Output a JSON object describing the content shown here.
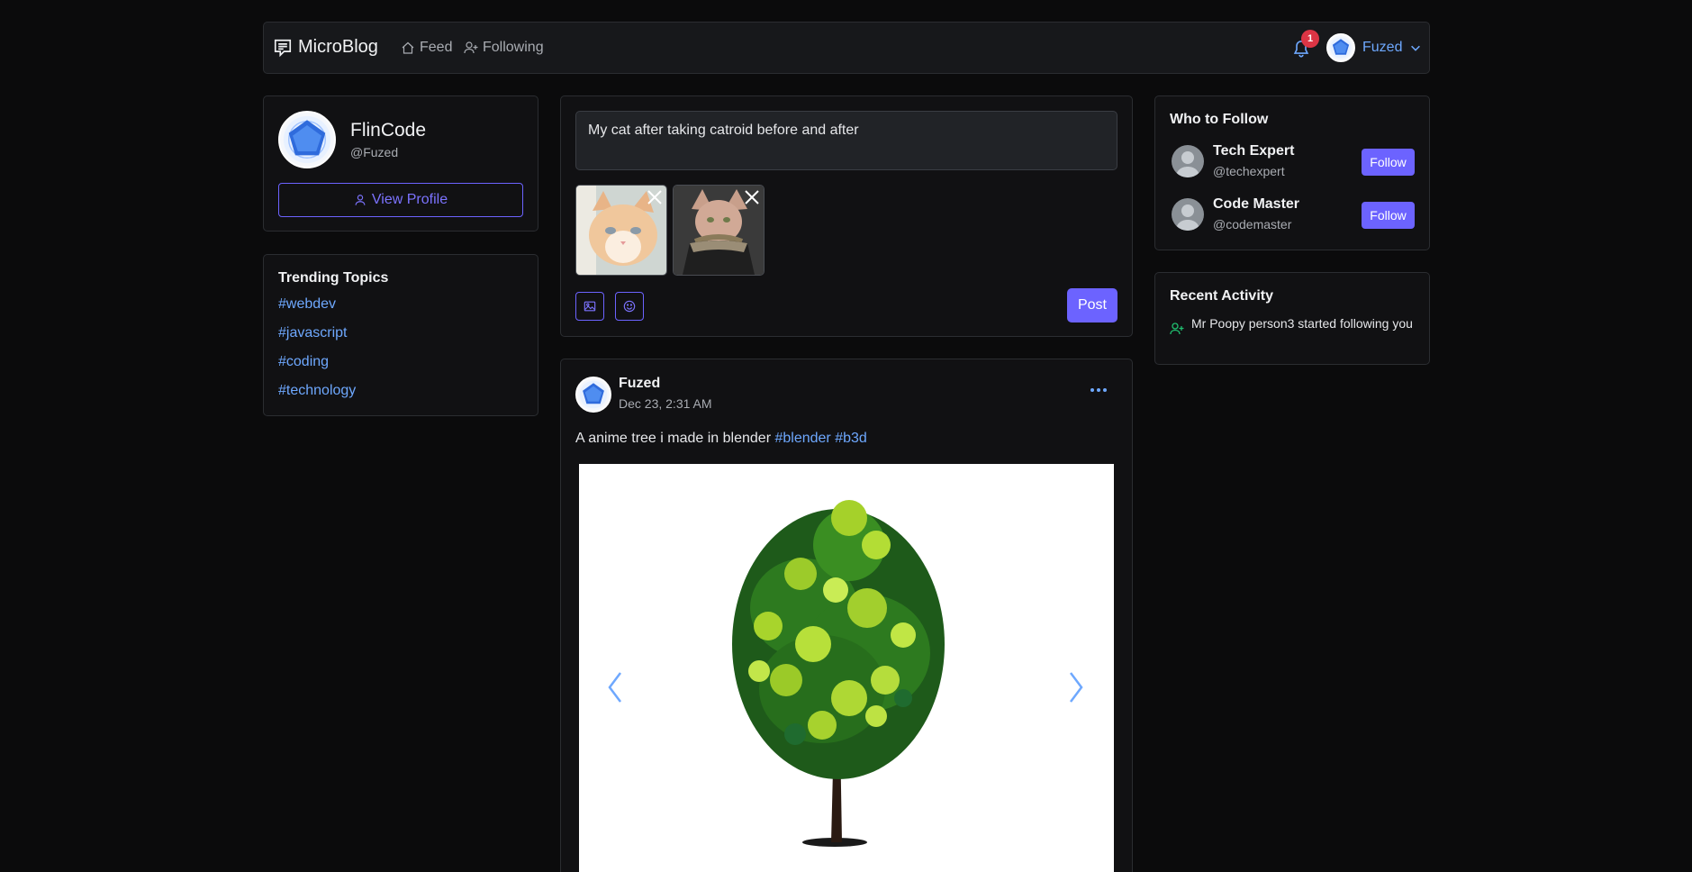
{
  "navbar": {
    "brand": "MicroBlog",
    "feed_label": "Feed",
    "following_label": "Following",
    "notification_count": "1",
    "username": "Fuzed"
  },
  "profile": {
    "name": "FlinCode",
    "handle": "@Fuzed",
    "view_profile_label": "View Profile"
  },
  "trending": {
    "title": "Trending Topics",
    "topics": [
      "#webdev",
      "#javascript",
      "#coding",
      "#technology"
    ]
  },
  "composer": {
    "text": "My cat after taking catroid before and after",
    "post_label": "Post"
  },
  "post": {
    "author": "Fuzed",
    "time": "Dec 23, 2:31 AM",
    "text": "A anime tree i made in blender",
    "tags": [
      "#blender",
      "#b3d"
    ]
  },
  "who_to_follow": {
    "title": "Who to Follow",
    "users": [
      {
        "name": "Tech Expert",
        "handle": "@techexpert",
        "button": "Follow"
      },
      {
        "name": "Code Master",
        "handle": "@codemaster",
        "button": "Follow"
      }
    ]
  },
  "recent_activity": {
    "title": "Recent Activity",
    "items": [
      "Mr Poopy person3 started following you"
    ]
  },
  "colors": {
    "accent": "#6c63ff",
    "link": "#6ea8fe",
    "badge": "#dc3545",
    "background": "#0b0b0c",
    "card": "#111113"
  }
}
